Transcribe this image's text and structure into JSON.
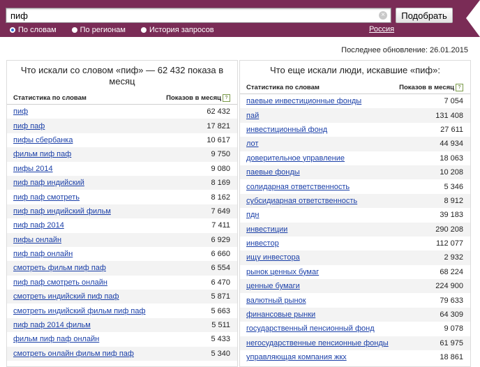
{
  "search": {
    "query": "пиф",
    "submit_label": "Подобрать",
    "clear_symbol": "×"
  },
  "filters": [
    {
      "label": "По словам",
      "checked": true
    },
    {
      "label": "По регионам",
      "checked": false
    },
    {
      "label": "История запросов",
      "checked": false
    }
  ],
  "region": "Россия",
  "last_update": "Последнее обновление: 26.01.2015",
  "left_panel": {
    "title": "Что искали со словом «пиф» — 62 432 показа в месяц",
    "col_stats": "Статистика по словам",
    "col_count": "Показов в месяц",
    "help": "?",
    "rows": [
      {
        "phrase": "пиф",
        "count": "62 432"
      },
      {
        "phrase": "пиф паф",
        "count": "17 821"
      },
      {
        "phrase": "пифы сбербанка",
        "count": "10 617"
      },
      {
        "phrase": "фильм пиф паф",
        "count": "9 750"
      },
      {
        "phrase": "пифы 2014",
        "count": "9 080"
      },
      {
        "phrase": "пиф паф индийский",
        "count": "8 169"
      },
      {
        "phrase": "пиф паф смотреть",
        "count": "8 162"
      },
      {
        "phrase": "пиф паф индийский фильм",
        "count": "7 649"
      },
      {
        "phrase": "пиф паф 2014",
        "count": "7 411"
      },
      {
        "phrase": "пифы онлайн",
        "count": "6 929"
      },
      {
        "phrase": "пиф паф онлайн",
        "count": "6 660"
      },
      {
        "phrase": "смотреть фильм пиф паф",
        "count": "6 554"
      },
      {
        "phrase": "пиф паф смотреть онлайн",
        "count": "6 470"
      },
      {
        "phrase": "смотреть индийский пиф паф",
        "count": "5 871"
      },
      {
        "phrase": "смотреть индийский фильм пиф паф",
        "count": "5 663"
      },
      {
        "phrase": "пиф паф 2014 фильм",
        "count": "5 511"
      },
      {
        "phrase": "фильм пиф паф онлайн",
        "count": "5 433"
      },
      {
        "phrase": "смотреть онлайн фильм пиф паф",
        "count": "5 340"
      }
    ]
  },
  "right_panel": {
    "title": "Что еще искали люди, искавшие «пиф»:",
    "col_stats": "Статистика по словам",
    "col_count": "Показов в месяц",
    "help": "?",
    "rows": [
      {
        "phrase": "паевые инвестиционные фонды",
        "count": "7 054"
      },
      {
        "phrase": "пай",
        "count": "131 408"
      },
      {
        "phrase": "инвестиционный фонд",
        "count": "27 611"
      },
      {
        "phrase": "лот",
        "count": "44 934"
      },
      {
        "phrase": "доверительное управление",
        "count": "18 063"
      },
      {
        "phrase": "паевые фонды",
        "count": "10 208"
      },
      {
        "phrase": "солидарная ответственность",
        "count": "5 346"
      },
      {
        "phrase": "субсидиарная ответственность",
        "count": "8 912"
      },
      {
        "phrase": "пдн",
        "count": "39 183"
      },
      {
        "phrase": "инвестиции",
        "count": "290 208"
      },
      {
        "phrase": "инвестор",
        "count": "112 077"
      },
      {
        "phrase": "ищу инвестора",
        "count": "2 932"
      },
      {
        "phrase": "рынок ценных бумаг",
        "count": "68 224"
      },
      {
        "phrase": "ценные бумаги",
        "count": "224 900"
      },
      {
        "phrase": "валютный рынок",
        "count": "79 633"
      },
      {
        "phrase": "финансовые рынки",
        "count": "64 309"
      },
      {
        "phrase": "государственный пенсионный фонд",
        "count": "9 078"
      },
      {
        "phrase": "негосударственные пенсионные фонды",
        "count": "61 975"
      },
      {
        "phrase": "управляющая компания жкх",
        "count": "18 861"
      }
    ]
  }
}
